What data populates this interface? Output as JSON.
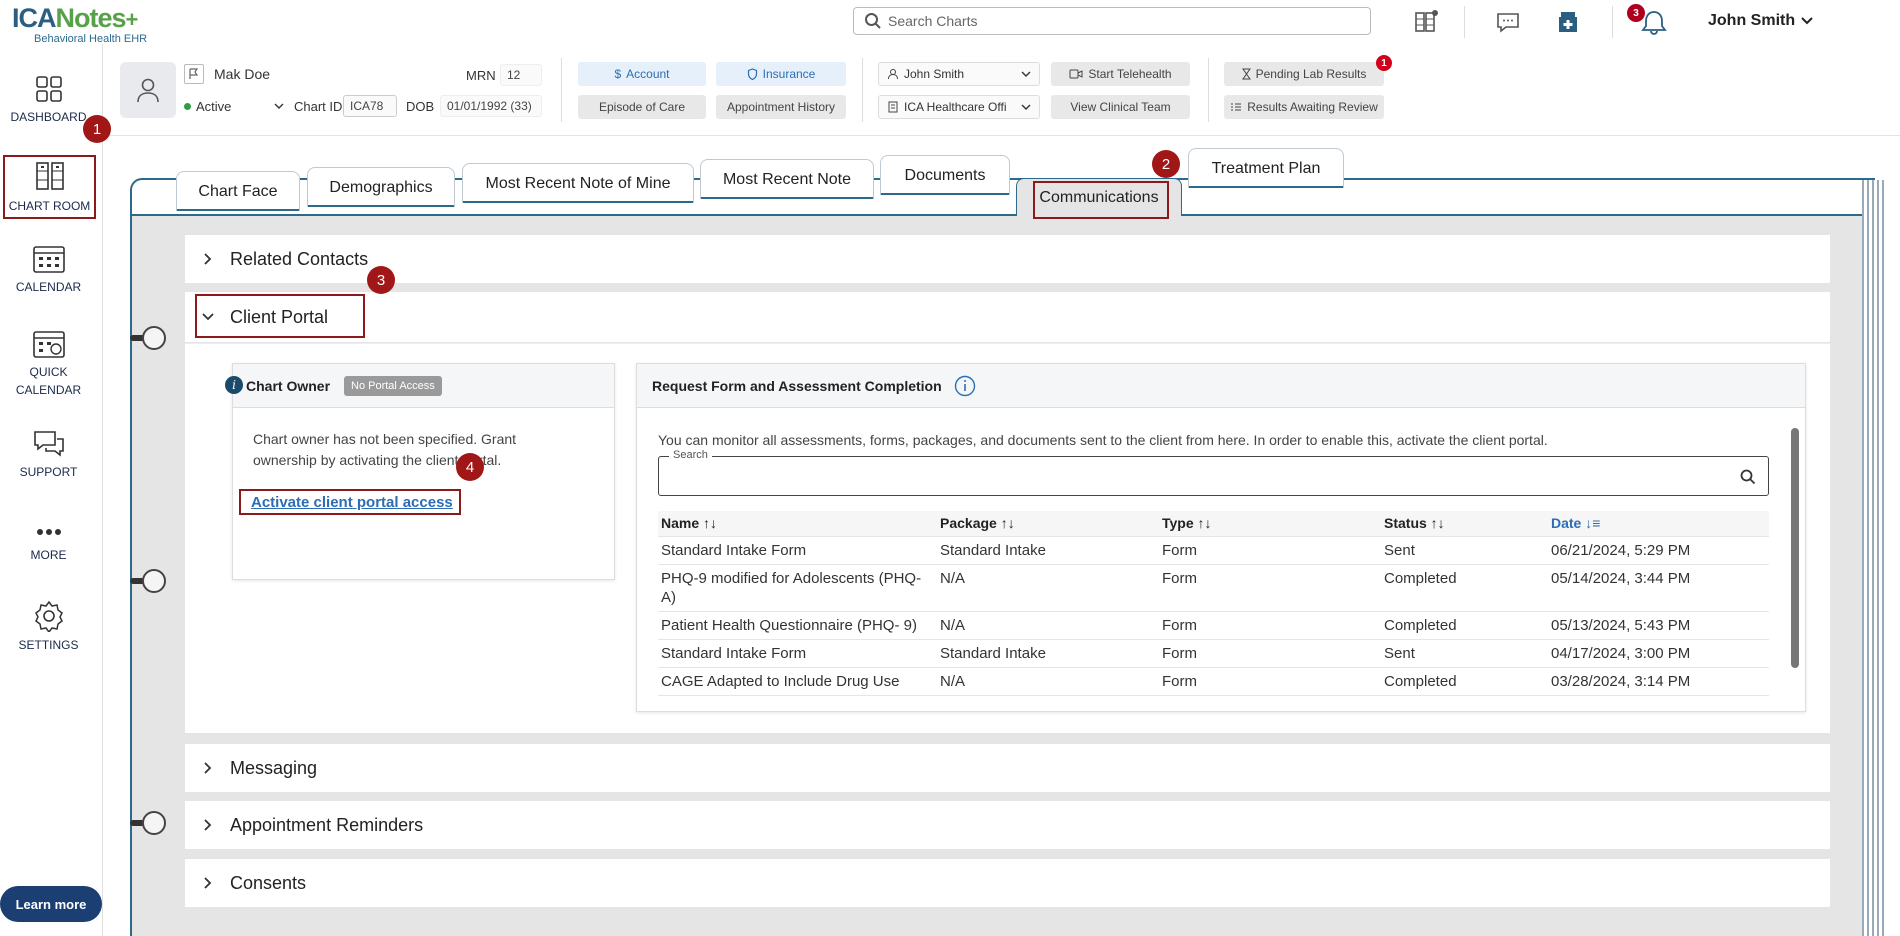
{
  "app": {
    "logo_main_a": "ICA",
    "logo_main_b": "Notes",
    "logo_sub": "Behavioral Health EHR",
    "search_placeholder": "Search Charts",
    "notifications_count": "3",
    "user_name": "John Smith"
  },
  "sidebar": {
    "items": [
      {
        "label": "DASHBOARD"
      },
      {
        "label": "CHART ROOM"
      },
      {
        "label": "CALENDAR"
      },
      {
        "label": "QUICK\nCALENDAR"
      },
      {
        "label": "SUPPORT"
      },
      {
        "label": "MORE"
      },
      {
        "label": "SETTINGS"
      }
    ],
    "learn_more": "Learn more"
  },
  "steps": [
    "1",
    "2",
    "3",
    "4"
  ],
  "patient": {
    "name": "Mak Doe",
    "status": "Active",
    "mrn_label": "MRN",
    "mrn": "12",
    "chart_id_label": "Chart ID",
    "chart_id": "ICA78",
    "dob_label": "DOB",
    "dob": "01/01/1992 (33)"
  },
  "header_buttons": {
    "account": "Account",
    "insurance": "Insurance",
    "episode": "Episode of Care",
    "appt_history": "Appointment History",
    "provider": "John Smith",
    "location": "ICA Healthcare Offi",
    "telehealth": "Start Telehealth",
    "clinical_team": "View Clinical Team",
    "pending_labs": "Pending Lab Results",
    "pending_labs_count": "1",
    "results_review": "Results Awaiting Review"
  },
  "tabs": [
    "Chart Face",
    "Demographics",
    "Most Recent Note of Mine",
    "Most Recent Note",
    "Documents",
    "Communications",
    "Treatment Plan"
  ],
  "sections": {
    "related_contacts": "Related Contacts",
    "client_portal": "Client Portal",
    "messaging": "Messaging",
    "appointment_reminders": "Appointment Reminders",
    "consents": "Consents"
  },
  "owner_card": {
    "title": "Chart Owner",
    "badge": "No Portal Access",
    "text": "Chart owner has not been specified. Grant ownership by activating the client portal.",
    "link": "Activate client portal access"
  },
  "request_card": {
    "title": "Request Form and Assessment Completion",
    "description": "You can monitor all assessments, forms, packages, and documents sent to the client from here. In order to enable this, activate the client portal.",
    "search_label": "Search",
    "columns": [
      "Name",
      "Package",
      "Type",
      "Status",
      "Date"
    ],
    "rows": [
      [
        "Standard Intake Form",
        "Standard Intake",
        "Form",
        "Sent",
        "06/21/2024, 5:29 PM"
      ],
      [
        "PHQ-9 modified for Adolescents (PHQ-A)",
        "N/A",
        "Form",
        "Completed",
        "05/14/2024, 3:44 PM"
      ],
      [
        "Patient Health Questionnaire (PHQ- 9)",
        "N/A",
        "Form",
        "Completed",
        "05/13/2024, 5:43 PM"
      ],
      [
        "Standard Intake Form",
        "Standard Intake",
        "Form",
        "Sent",
        "04/17/2024, 3:00 PM"
      ],
      [
        "CAGE Adapted to Include Drug Use",
        "N/A",
        "Form",
        "Completed",
        "03/28/2024, 3:14 PM"
      ]
    ]
  },
  "colors": {
    "brand_blue": "#2b5f82",
    "brand_green": "#57a14a",
    "highlight_red": "#8b1a1a",
    "book_blue": "#2c6a8c",
    "link_blue": "#2c6db5"
  }
}
